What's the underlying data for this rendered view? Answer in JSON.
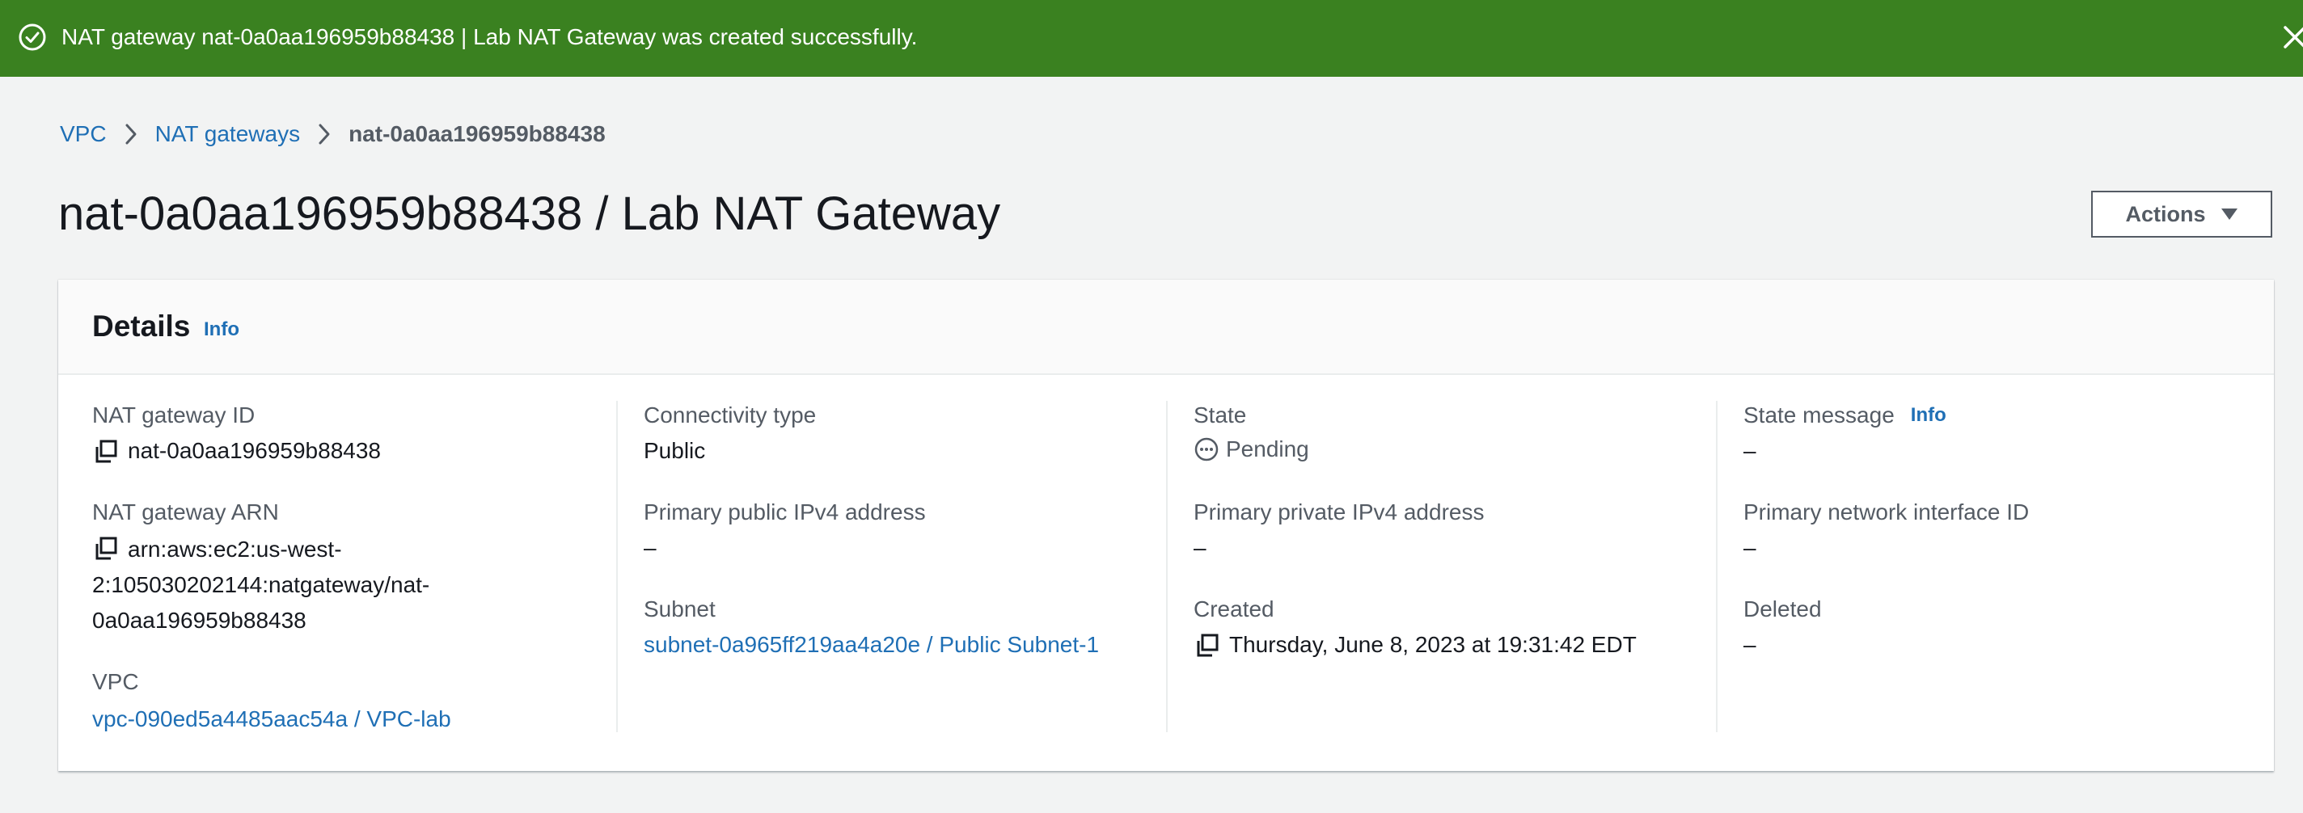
{
  "flash": {
    "message": "NAT gateway nat-0a0aa196959b88438 | Lab NAT Gateway was created successfully.",
    "success_color": "#3a8120"
  },
  "breadcrumb": {
    "items": [
      {
        "label": "VPC"
      },
      {
        "label": "NAT gateways"
      }
    ],
    "current": "nat-0a0aa196959b88438"
  },
  "page": {
    "title": "nat-0a0aa196959b88438 / Lab NAT Gateway",
    "actions_label": "Actions"
  },
  "details": {
    "title": "Details",
    "info_label": "Info",
    "columns": [
      {
        "fields": [
          {
            "label": "NAT gateway ID",
            "value": "nat-0a0aa196959b88438"
          },
          {
            "label": "NAT gateway ARN",
            "value_lines": [
              "arn:aws:ec2:us-west-",
              "2:105030202144:natgateway/nat-",
              "0a0aa196959b88438"
            ]
          },
          {
            "label": "VPC",
            "value": "vpc-090ed5a4485aac54a / VPC-lab"
          }
        ]
      },
      {
        "fields": [
          {
            "label": "Connectivity type",
            "value": "Public"
          },
          {
            "label": "Primary public IPv4 address",
            "value": "–"
          },
          {
            "label": "Subnet",
            "value": "subnet-0a965ff219aa4a20e / Public Subnet-1"
          }
        ]
      },
      {
        "fields": [
          {
            "label": "State",
            "value": "Pending"
          },
          {
            "label": "Primary private IPv4 address",
            "value": "–"
          },
          {
            "label": "Created",
            "value": "Thursday, June 8, 2023 at 19:31:42 EDT"
          }
        ]
      },
      {
        "fields": [
          {
            "label": "State message",
            "info": "Info",
            "value": "–"
          },
          {
            "label": "Primary network interface ID",
            "value": "–"
          },
          {
            "label": "Deleted",
            "value": "–"
          }
        ]
      }
    ]
  },
  "icons": {
    "flash_status": "success-check-circle-icon",
    "flash_close": "close-icon",
    "breadcrumb_separator": "chevron-right-icon",
    "actions_caret": "caret-down-icon",
    "copy": "copy-icon",
    "pending": "pending-status-icon"
  },
  "colors": {
    "link": "#1f6fb5",
    "page_background": "#f2f3f3"
  }
}
